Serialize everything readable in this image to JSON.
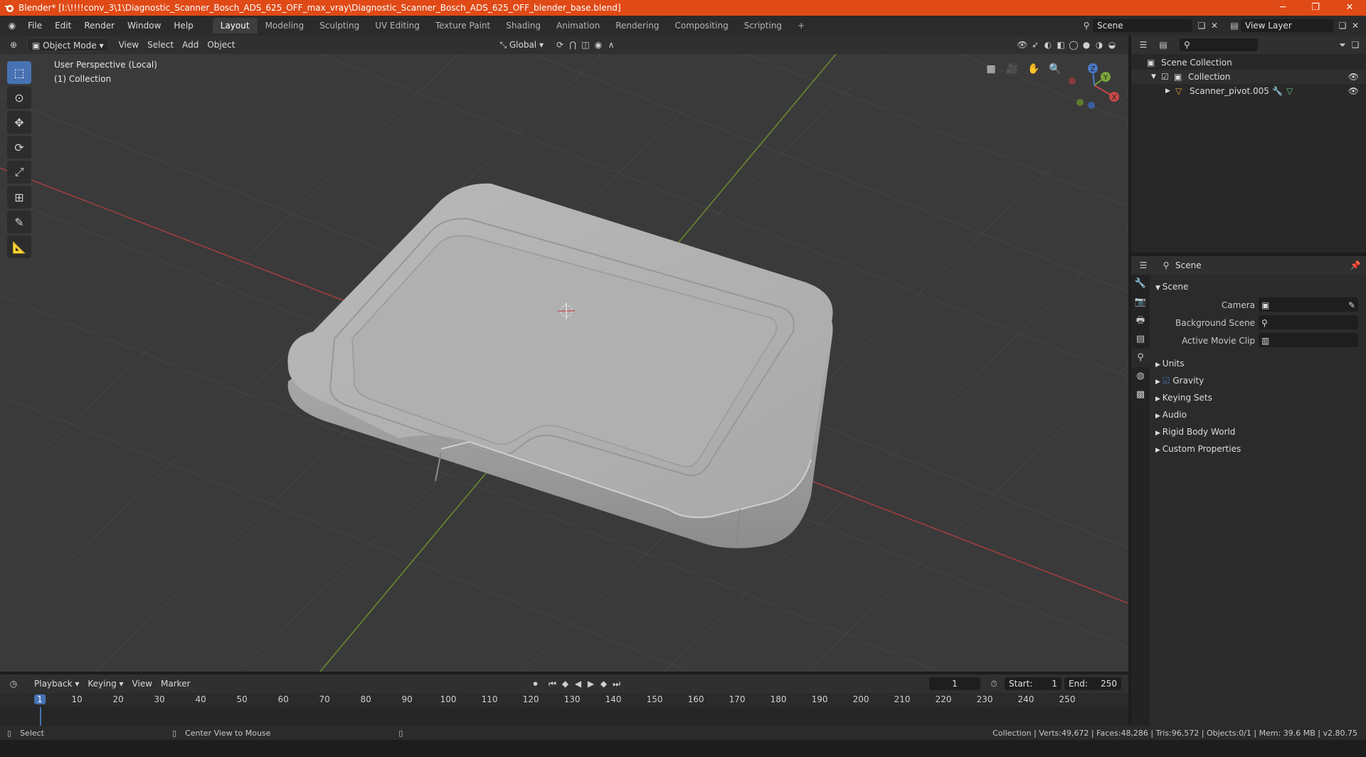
{
  "window": {
    "title": "Blender* [I:\\!!!!conv_3\\1\\Diagnostic_Scanner_Bosch_ADS_625_OFF_max_vray\\Diagnostic_Scanner_Bosch_ADS_625_OFF_blender_base.blend]",
    "minimize": "─",
    "maximize": "❐",
    "close": "✕"
  },
  "menu": [
    "File",
    "Edit",
    "Render",
    "Window",
    "Help"
  ],
  "workspaces": [
    "Layout",
    "Modeling",
    "Sculpting",
    "UV Editing",
    "Texture Paint",
    "Shading",
    "Animation",
    "Rendering",
    "Compositing",
    "Scripting"
  ],
  "active_workspace": "Layout",
  "add_workspace": "+",
  "scene_selector": "Scene",
  "view_layer_selector": "View Layer",
  "viewport_header": {
    "mode": "Object Mode",
    "menus": [
      "View",
      "Select",
      "Add",
      "Object"
    ],
    "transform_orientation": "Global"
  },
  "viewport": {
    "perspective_label": "User Perspective (Local)",
    "collection_label": "(1) Collection",
    "gizmo": {
      "x": "X",
      "y": "Y",
      "z": "Z"
    },
    "colors": {
      "x_axis": "#c84646",
      "y_axis": "#7aa33a",
      "background": "#3a3a3a",
      "grid": "#454545"
    }
  },
  "outliner": {
    "root": "Scene Collection",
    "collection": "Collection",
    "object": "Scanner_pivot.005"
  },
  "properties": {
    "context": "Scene",
    "panel_title": "Scene",
    "fields": [
      {
        "label": "Camera",
        "value": ""
      },
      {
        "label": "Background Scene",
        "value": ""
      },
      {
        "label": "Active Movie Clip",
        "value": ""
      }
    ],
    "sections": [
      "Units",
      "Gravity",
      "Keying Sets",
      "Audio",
      "Rigid Body World",
      "Custom Properties"
    ]
  },
  "timeline": {
    "menus": [
      "Playback",
      "Keying",
      "View",
      "Marker"
    ],
    "current_frame": "1",
    "start_label": "Start:",
    "start": "1",
    "end_label": "End:",
    "end": "250",
    "ticks": [
      "1",
      "10",
      "20",
      "30",
      "40",
      "50",
      "60",
      "70",
      "80",
      "90",
      "100",
      "110",
      "120",
      "130",
      "140",
      "150",
      "160",
      "170",
      "180",
      "190",
      "200",
      "210",
      "220",
      "230",
      "240",
      "250"
    ]
  },
  "statusbar": {
    "select": "Select",
    "center_view": "Center View to Mouse",
    "stats": "Collection | Verts:49,672 | Faces:48,286 | Tris:96,572 | Objects:0/1 | Mem: 39.6 MB | v2.80.75"
  }
}
